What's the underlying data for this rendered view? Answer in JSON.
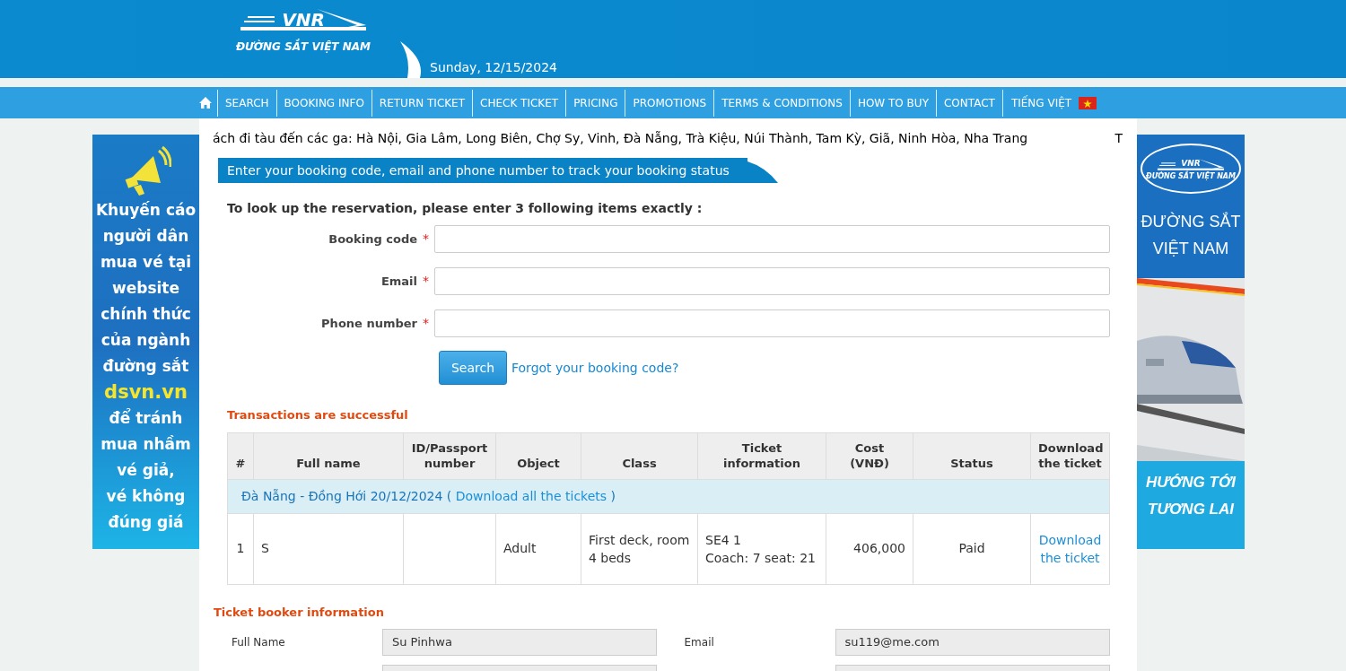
{
  "header": {
    "logo_text": "VNR",
    "logo_caption": "ĐƯỜNG SẮT VIỆT NAM",
    "date": "Sunday, 12/15/2024"
  },
  "nav": [
    {
      "kind": "home"
    },
    {
      "kind": "link",
      "label": "SEARCH"
    },
    {
      "kind": "link",
      "label": "BOOKING INFO"
    },
    {
      "kind": "link",
      "label": "RETURN TICKET"
    },
    {
      "kind": "link",
      "label": "CHECK TICKET"
    },
    {
      "kind": "link",
      "label": "PRICING"
    },
    {
      "kind": "link",
      "label": "PROMOTIONS"
    },
    {
      "kind": "link",
      "label": "TERMS & CONDITIONS"
    },
    {
      "kind": "link",
      "label": "HOW TO BUY"
    },
    {
      "kind": "link",
      "label": "CONTACT"
    },
    {
      "kind": "language",
      "label": "TIẾNG VIỆT"
    }
  ],
  "ticker": [
    "ách đi tàu đến các ga: Hà Nội, Gia Lâm, Long Biên, Chợ Sy, Vinh, Đà Nẵng, Trà Kiệu, Núi Thành, Tam Kỳ, Giã, Ninh Hòa, Nha Trang",
    "T"
  ],
  "left_banner": {
    "lines": [
      {
        "kind": "text",
        "text": "Khuyến cáo"
      },
      {
        "kind": "text",
        "text": "người dân"
      },
      {
        "kind": "text",
        "text": "mua vé tại"
      },
      {
        "kind": "text",
        "text": "website"
      },
      {
        "kind": "text",
        "text": "chính thức"
      },
      {
        "kind": "text",
        "text": "của ngành"
      },
      {
        "kind": "text",
        "text": "đường sắt"
      },
      {
        "kind": "highlight",
        "text": "dsvn.vn"
      },
      {
        "kind": "text",
        "text": "để tránh"
      },
      {
        "kind": "text",
        "text": "mua nhầm"
      },
      {
        "kind": "text",
        "text": "vé giả,"
      },
      {
        "kind": "text",
        "text": "vé không"
      },
      {
        "kind": "text",
        "text": "đúng giá"
      }
    ]
  },
  "right_banner": {
    "logo_text": "VNR",
    "logo_caption": "ĐƯỜNG SẮT VIỆT NAM",
    "title_lines": [
      "ĐƯỜNG SẮT",
      "VIỆT NAM"
    ],
    "slogan_lines": [
      "HƯỚNG TỚI",
      "TƯƠNG LAI"
    ]
  },
  "lookup": {
    "heading": "Enter your booking code, email and phone number to track your booking status",
    "instruction": "To look up the reservation, please enter 3 following items exactly :",
    "fields": [
      {
        "label": "Booking code",
        "required": true
      },
      {
        "label": "Email",
        "required": true
      },
      {
        "label": "Phone number",
        "required": true
      }
    ],
    "required_mark": "*",
    "search_button": "Search",
    "forgot_link": "Forgot your booking code?"
  },
  "transactions": {
    "title": "Transactions are successful",
    "columns": [
      "#",
      "Full name",
      "ID/Passport number",
      "Object",
      "Class",
      "Ticket information",
      "Cost (VNĐ)",
      "Status",
      "Download the ticket"
    ],
    "groups": [
      {
        "route": "Đà Nẵng - Đồng Hới 20/12/2024",
        "open": "(",
        "link": "Download all the tickets",
        "close": ")",
        "rows": [
          {
            "number": "1",
            "full_name": "S",
            "object": "Adult",
            "class": "First deck, room 4 beds",
            "ticket_lines": [
              "SE4 1",
              "Coach: 7 seat: 21"
            ],
            "cost": "406,000",
            "status": "Paid",
            "download": "Download the ticket"
          }
        ]
      }
    ]
  },
  "booker": {
    "title": "Ticket booker information",
    "fields": [
      {
        "kind": "labeled",
        "label": "Full Name",
        "value": "Su Pinhwa"
      },
      {
        "kind": "labeled",
        "label": "Email",
        "value": "su119@me.com"
      },
      {
        "kind": "blank"
      },
      {
        "kind": "blank"
      }
    ]
  }
}
